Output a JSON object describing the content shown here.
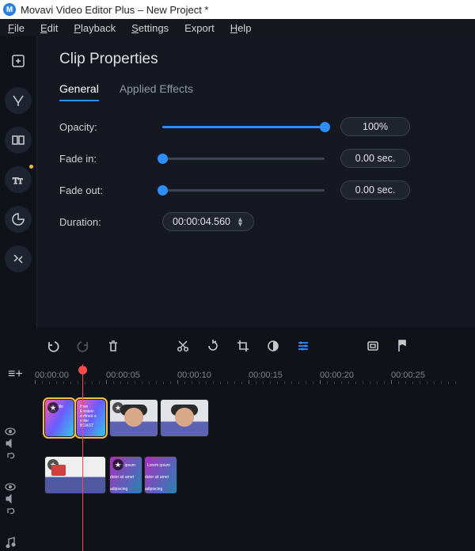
{
  "titlebar": {
    "app_title": "Movavi Video Editor Plus – New Project *"
  },
  "menu": {
    "file": "File",
    "edit": "Edit",
    "playback": "Playback",
    "settings": "Settings",
    "export": "Export",
    "help": "Help"
  },
  "left_tools": {
    "add_media": "add-media",
    "magic": "magic-wand",
    "transitions": "transitions",
    "titles": "titles",
    "time": "time-effects",
    "tools": "more-tools"
  },
  "panel": {
    "title": "Clip Properties",
    "tabs": {
      "general": "General",
      "effects": "Applied Effects"
    },
    "opacity_label": "Opacity:",
    "opacity_value": "100%",
    "fadein_label": "Fade in:",
    "fadein_value": "0.00 sec.",
    "fadeout_label": "Fade out:",
    "fadeout_value": "0.00 sec.",
    "duration_label": "Duration:",
    "duration_value": "00:00:04.560"
  },
  "timeline_toolbar": {
    "undo": "undo",
    "redo": "redo",
    "delete": "delete",
    "cut": "cut",
    "rotate": "rotate",
    "crop": "crop",
    "color": "color-adjust",
    "props": "clip-properties",
    "record": "record-vo",
    "marker": "add-marker"
  },
  "ruler": {
    "labels": [
      "00:00:00",
      "00:00:05",
      "00:00:10",
      "00:00:15",
      "00:00:20",
      "00:00:25"
    ]
  },
  "tracks": {
    "add_track": "≡+",
    "clips": {
      "c1_text": "intro title card",
      "c2_text": "How Einstein defined a roller BOAST",
      "c3_text": "Lorem ipsum dolor sit amet adipiscing",
      "c4_text": "Lorem ipsum dolor sit amet adipiscing"
    }
  }
}
